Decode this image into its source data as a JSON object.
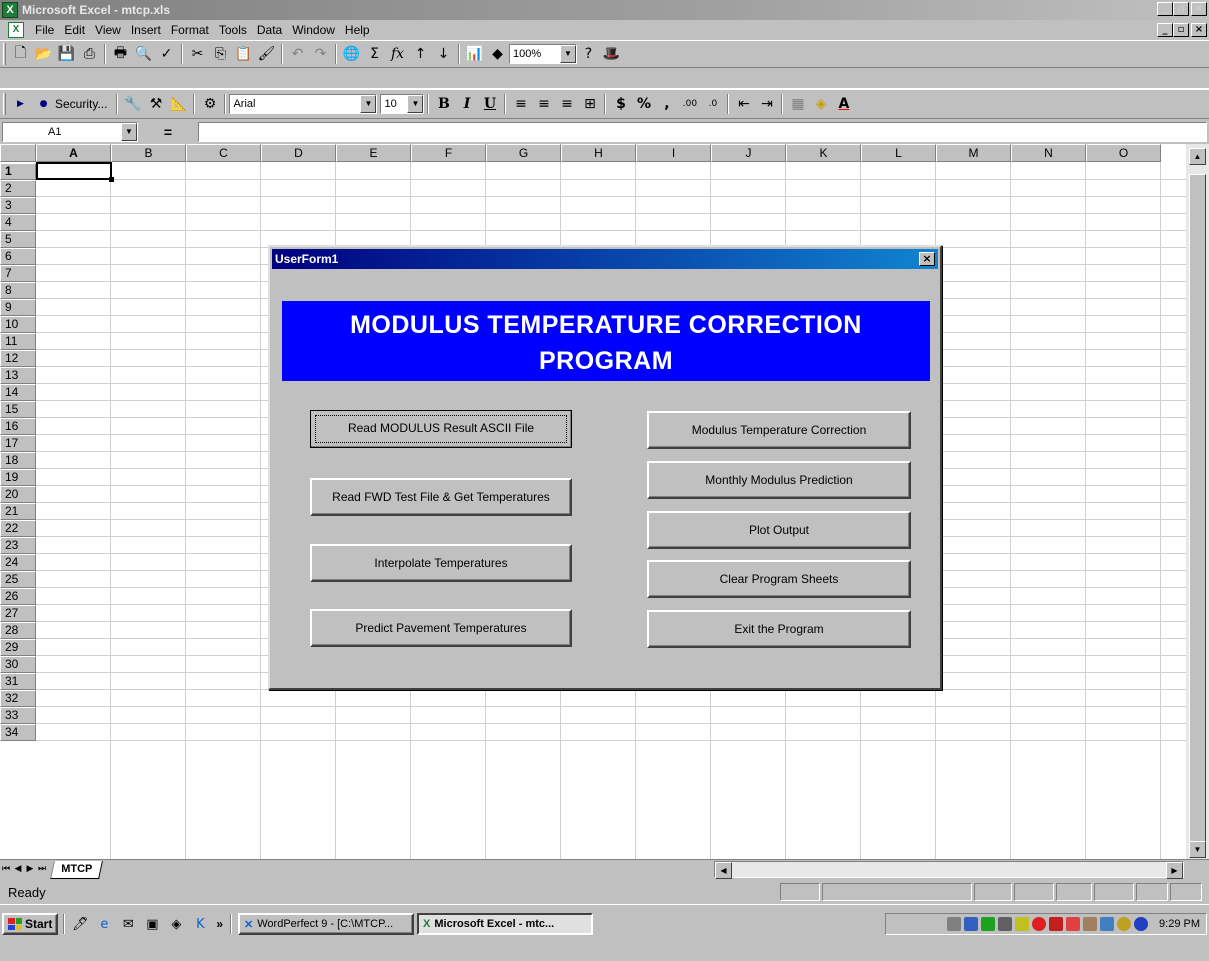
{
  "window": {
    "title": "Microsoft Excel - mtcp.xls"
  },
  "menu": {
    "items": [
      "File",
      "Edit",
      "View",
      "Insert",
      "Format",
      "Tools",
      "Data",
      "Window",
      "Help"
    ]
  },
  "toolbar": {
    "zoom": "100%",
    "security_label": "Security...",
    "font_name": "Arial",
    "font_size": "10"
  },
  "formula_bar": {
    "name_box": "A1",
    "equals": "=",
    "content": ""
  },
  "sheet": {
    "columns": [
      "A",
      "B",
      "C",
      "D",
      "E",
      "F",
      "G",
      "H",
      "I",
      "J",
      "K",
      "L",
      "M",
      "N",
      "O"
    ],
    "rows": [
      "1",
      "2",
      "3",
      "4",
      "5",
      "6",
      "7",
      "8",
      "9",
      "10",
      "11",
      "12",
      "13",
      "14",
      "15",
      "16",
      "17",
      "18",
      "19",
      "20",
      "21",
      "22",
      "23",
      "24",
      "25",
      "26",
      "27",
      "28",
      "29",
      "30",
      "31",
      "32",
      "33",
      "34"
    ],
    "active_cell": "A1",
    "tab_name": "MTCP"
  },
  "status": {
    "text": "Ready"
  },
  "userform": {
    "title": "UserForm1",
    "close_glyph": "×",
    "banner_line1": "MODULUS TEMPERATURE CORRECTION",
    "banner_line2": "PROGRAM",
    "left_buttons": [
      "Read MODULUS Result ASCII File",
      "Read FWD Test File &  Get Temperatures",
      "Interpolate   Temperatures",
      "Predict Pavement Temperatures"
    ],
    "right_buttons": [
      "Modulus Temperature Correction",
      "Monthly Modulus Prediction",
      "Plot Output",
      "Clear Program Sheets",
      "Exit the Program"
    ]
  },
  "taskbar": {
    "start_label": "Start",
    "more": "»",
    "tasks": [
      "WordPerfect 9 - [C:\\MTCP...",
      "Microsoft Excel - mtc..."
    ],
    "clock": "9:29 PM"
  },
  "colors": {
    "banner_bg": "#0000ff",
    "form_title_start": "#000080",
    "form_title_end": "#1084d0",
    "face": "#c0c0c0"
  }
}
